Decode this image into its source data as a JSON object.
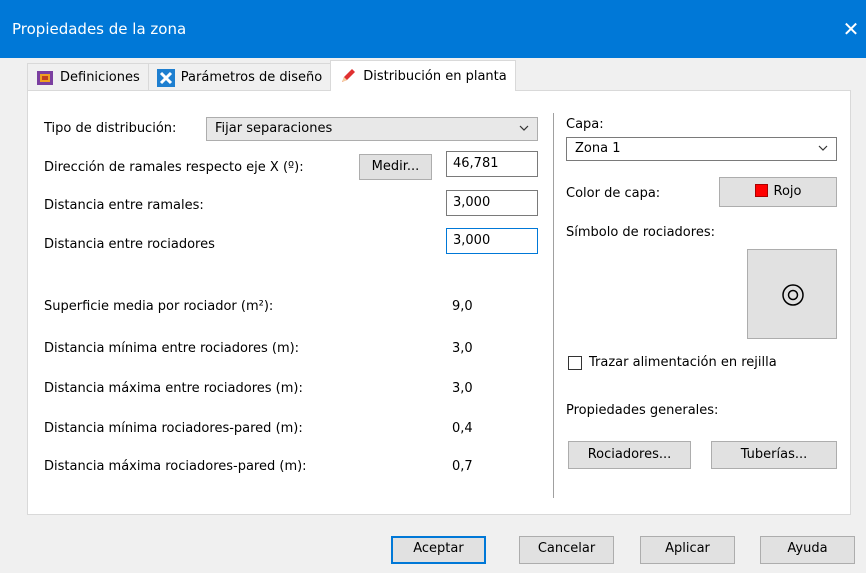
{
  "window": {
    "title": "Propiedades de la zona",
    "close_glyph": "✕"
  },
  "tabs": [
    {
      "label": "Definiciones",
      "icon": "definitions-icon",
      "active": false
    },
    {
      "label": "Parámetros de diseño",
      "icon": "tools-icon",
      "active": false
    },
    {
      "label": "Distribución en planta",
      "icon": "pencil-icon",
      "active": true
    }
  ],
  "layout": {
    "distribution_type_label": "Tipo de distribución:",
    "distribution_type_value": "Fijar separaciones",
    "direction_label": "Dirección de ramales respecto eje X (º):",
    "measure_button": "Medir...",
    "direction_value": "46,781",
    "branch_distance_label": "Distancia entre ramales:",
    "branch_distance_value": "3,000",
    "sprinkler_distance_label": "Distancia entre rociadores",
    "sprinkler_distance_value": "3,000"
  },
  "results": [
    {
      "label": "Superficie media por rociador (m²):",
      "value": "9,0"
    },
    {
      "label": "Distancia mínima entre rociadores (m):",
      "value": "3,0"
    },
    {
      "label": "Distancia máxima entre rociadores (m):",
      "value": "3,0"
    },
    {
      "label": "Distancia mínima rociadores-pared (m):",
      "value": "0,4"
    },
    {
      "label": "Distancia máxima rociadores-pared (m):",
      "value": "0,7"
    }
  ],
  "right": {
    "layer_label": "Capa:",
    "layer_value": "Zona 1",
    "layer_color_label": "Color de capa:",
    "layer_color_value": "Rojo",
    "layer_color_hex": "#ff0000",
    "symbol_label": "Símbolo de rociadores:",
    "grid_feed_label": "Trazar alimentación en rejilla",
    "grid_feed_checked": false,
    "general_props_label": "Propiedades generales:",
    "sprinklers_button": "Rociadores...",
    "pipes_button": "Tuberías..."
  },
  "footer": {
    "accept": "Aceptar",
    "cancel": "Cancelar",
    "apply": "Aplicar",
    "help": "Ayuda"
  },
  "colors": {
    "titlebar": "#0078d7",
    "focus_border": "#0078d7"
  }
}
